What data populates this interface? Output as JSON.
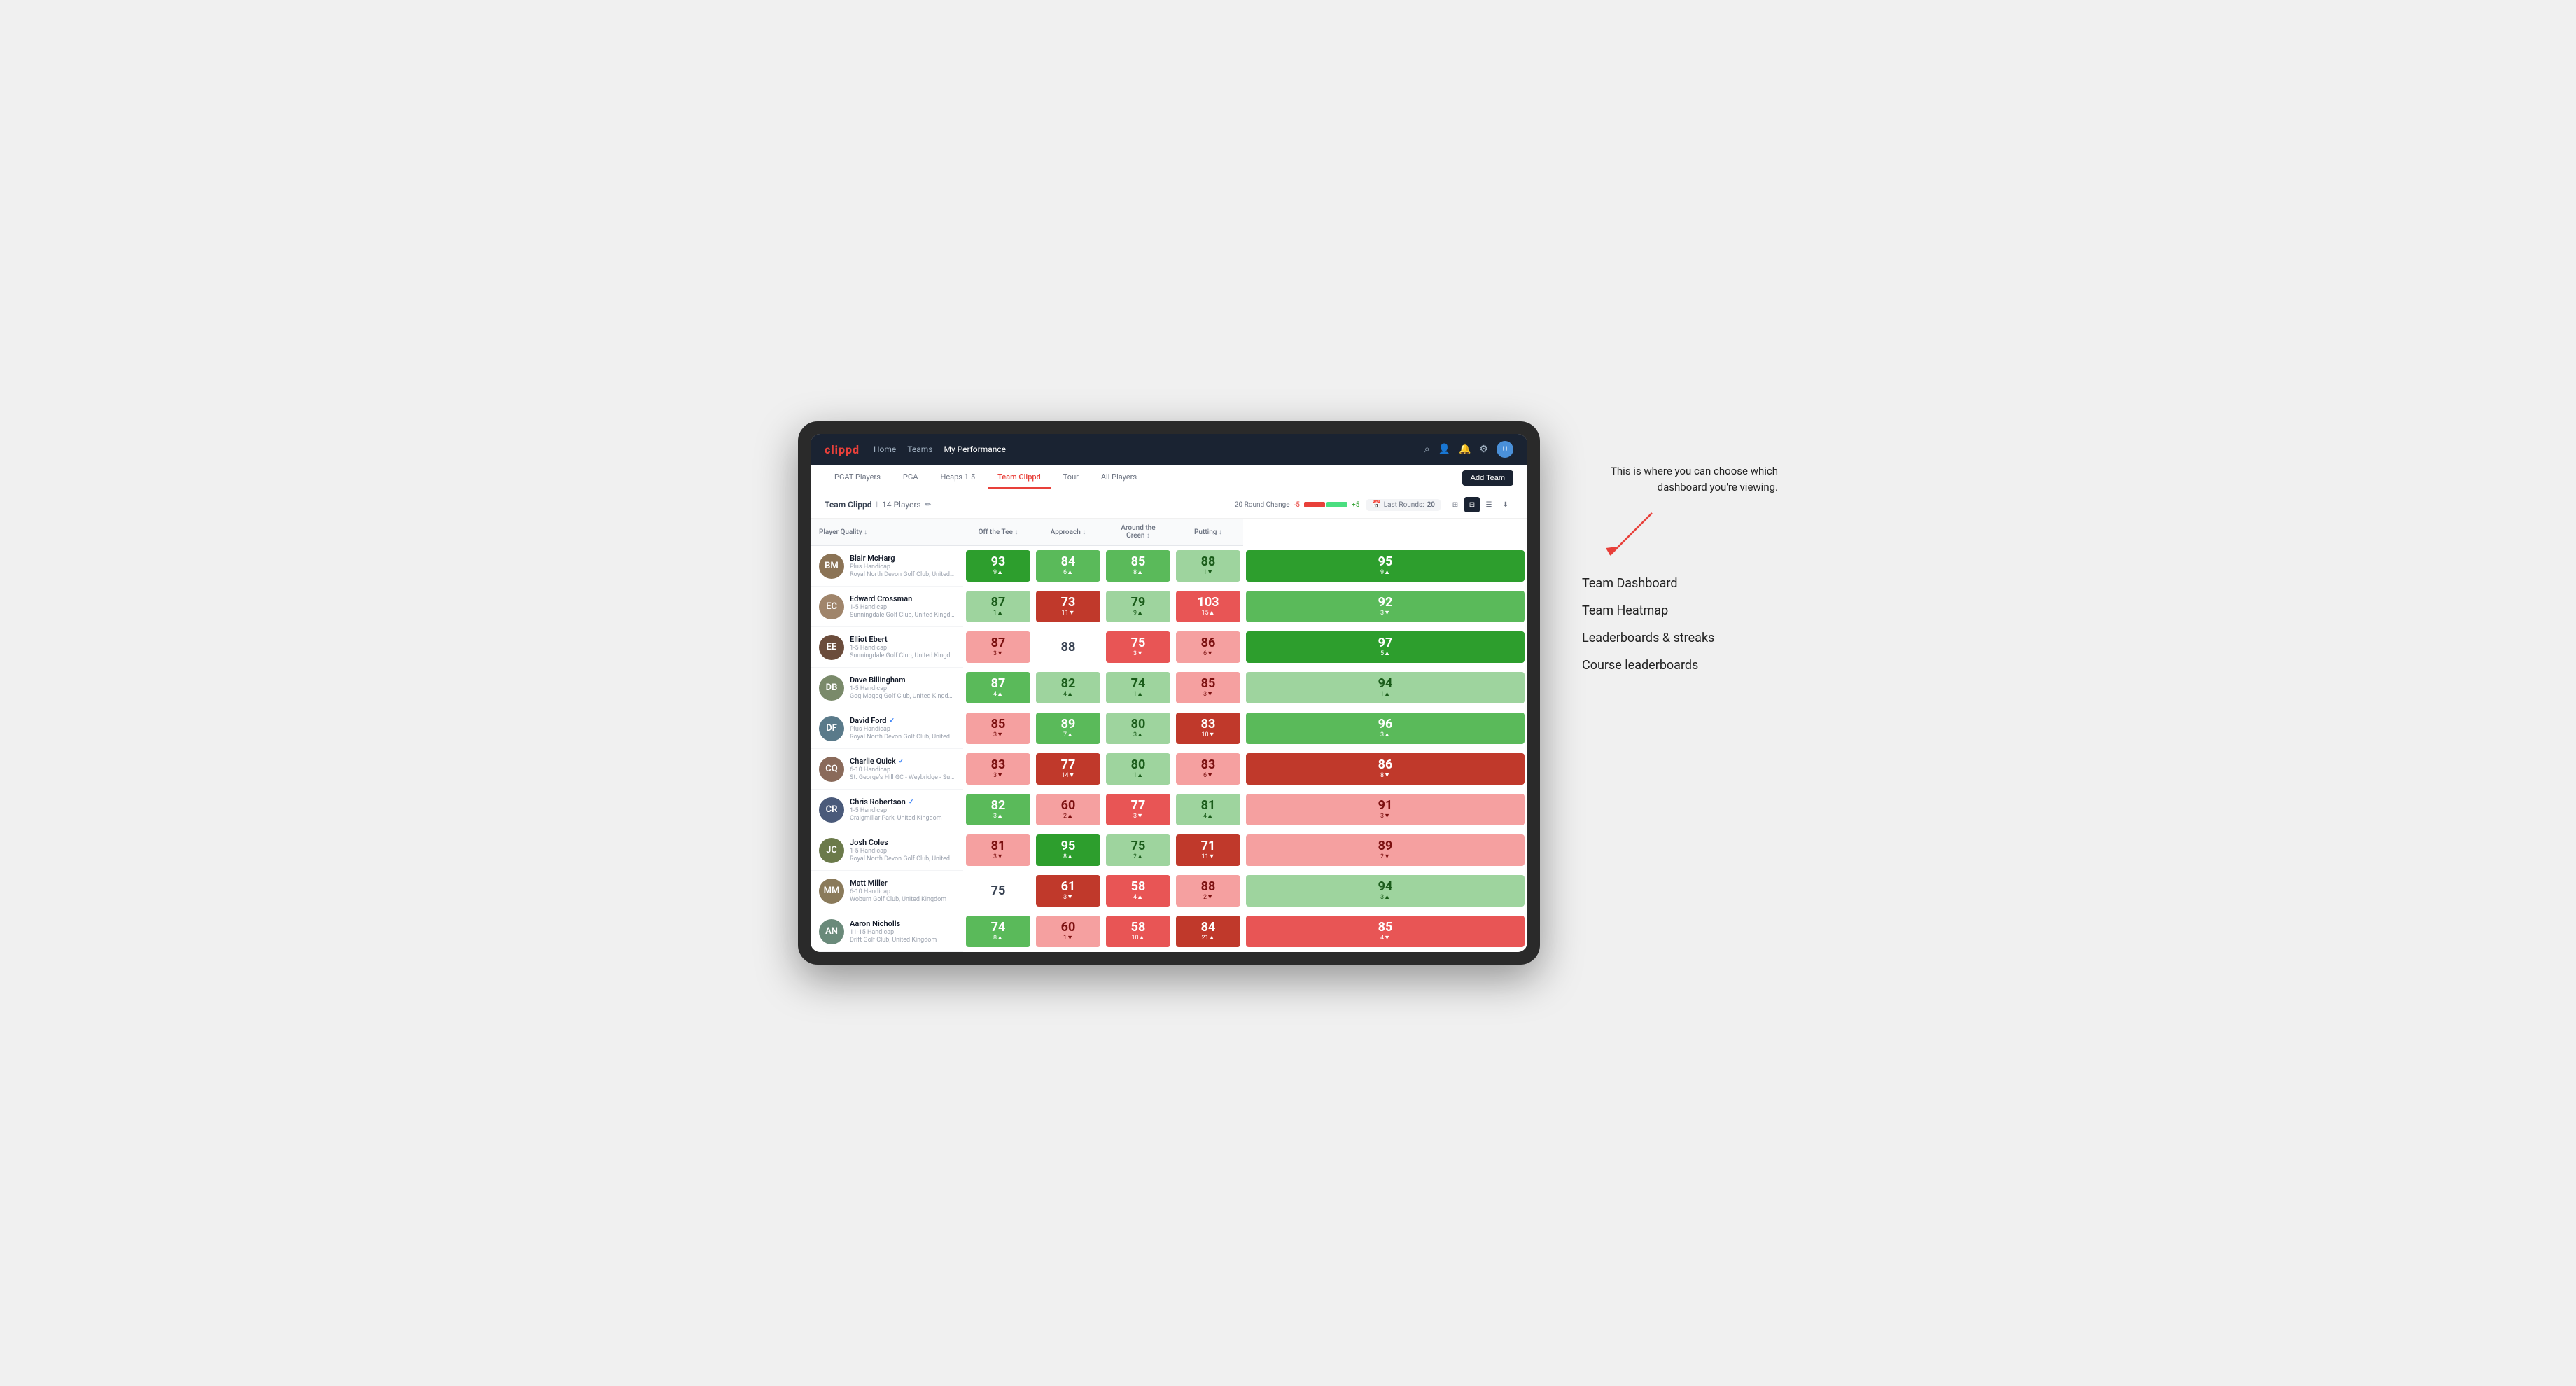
{
  "app": {
    "logo": "clippd",
    "nav": {
      "links": [
        "Home",
        "Teams",
        "My Performance"
      ],
      "active": "My Performance"
    },
    "icons": [
      "search",
      "person",
      "bell",
      "settings",
      "avatar"
    ]
  },
  "subnav": {
    "tabs": [
      "PGAT Players",
      "PGA",
      "Hcaps 1-5",
      "Team Clippd",
      "Tour",
      "All Players"
    ],
    "active": "Team Clippd",
    "add_button": "Add Team"
  },
  "team_header": {
    "title": "Team Clippd",
    "player_count": "14 Players",
    "round_change_label": "20 Round Change",
    "negative": "-5",
    "positive": "+5",
    "last_rounds_label": "Last Rounds:",
    "last_rounds_value": "20"
  },
  "table": {
    "columns": {
      "player": "Player Quality",
      "off_tee": "Off the Tee",
      "approach": "Approach",
      "around_green": "Around the Green",
      "putting": "Putting"
    },
    "rows": [
      {
        "name": "Blair McHarg",
        "handicap": "Plus Handicap",
        "club": "Royal North Devon Golf Club, United Kingdom",
        "avatar_color": "#8b7355",
        "scores": {
          "player_quality": {
            "value": "93",
            "change": "9▲",
            "color": "bg-green-dark"
          },
          "off_tee": {
            "value": "84",
            "change": "6▲",
            "color": "bg-green-mid"
          },
          "approach": {
            "value": "85",
            "change": "8▲",
            "color": "bg-green-mid"
          },
          "around_green": {
            "value": "88",
            "change": "1▼",
            "color": "bg-green-light"
          },
          "putting": {
            "value": "95",
            "change": "9▲",
            "color": "bg-green-dark"
          }
        }
      },
      {
        "name": "Edward Crossman",
        "handicap": "1-5 Handicap",
        "club": "Sunningdale Golf Club, United Kingdom",
        "avatar_color": "#a0856b",
        "scores": {
          "player_quality": {
            "value": "87",
            "change": "1▲",
            "color": "bg-green-light"
          },
          "off_tee": {
            "value": "73",
            "change": "11▼",
            "color": "bg-red-dark"
          },
          "approach": {
            "value": "79",
            "change": "9▲",
            "color": "bg-green-light"
          },
          "around_green": {
            "value": "103",
            "change": "15▲",
            "color": "bg-red-mid"
          },
          "putting": {
            "value": "92",
            "change": "3▼",
            "color": "bg-green-mid"
          }
        }
      },
      {
        "name": "Elliot Ebert",
        "handicap": "1-5 Handicap",
        "club": "Sunningdale Golf Club, United Kingdom",
        "avatar_color": "#6b4c3b",
        "scores": {
          "player_quality": {
            "value": "87",
            "change": "3▼",
            "color": "bg-red-light"
          },
          "off_tee": {
            "value": "88",
            "change": "",
            "color": "bg-white"
          },
          "approach": {
            "value": "75",
            "change": "3▼",
            "color": "bg-red-mid"
          },
          "around_green": {
            "value": "86",
            "change": "6▼",
            "color": "bg-red-light"
          },
          "putting": {
            "value": "97",
            "change": "5▲",
            "color": "bg-green-dark"
          }
        }
      },
      {
        "name": "Dave Billingham",
        "handicap": "1-5 Handicap",
        "club": "Gog Magog Golf Club, United Kingdom",
        "avatar_color": "#7a8a6a",
        "scores": {
          "player_quality": {
            "value": "87",
            "change": "4▲",
            "color": "bg-green-mid"
          },
          "off_tee": {
            "value": "82",
            "change": "4▲",
            "color": "bg-green-light"
          },
          "approach": {
            "value": "74",
            "change": "1▲",
            "color": "bg-green-light"
          },
          "around_green": {
            "value": "85",
            "change": "3▼",
            "color": "bg-red-light"
          },
          "putting": {
            "value": "94",
            "change": "1▲",
            "color": "bg-green-light"
          }
        }
      },
      {
        "name": "David Ford",
        "handicap": "Plus Handicap",
        "club": "Royal North Devon Golf Club, United Kingdom",
        "avatar_color": "#5a7a8a",
        "verified": true,
        "scores": {
          "player_quality": {
            "value": "85",
            "change": "3▼",
            "color": "bg-red-light"
          },
          "off_tee": {
            "value": "89",
            "change": "7▲",
            "color": "bg-green-mid"
          },
          "approach": {
            "value": "80",
            "change": "3▲",
            "color": "bg-green-light"
          },
          "around_green": {
            "value": "83",
            "change": "10▼",
            "color": "bg-red-dark"
          },
          "putting": {
            "value": "96",
            "change": "3▲",
            "color": "bg-green-mid"
          }
        }
      },
      {
        "name": "Charlie Quick",
        "handicap": "6-10 Handicap",
        "club": "St. George's Hill GC - Weybridge - Surrey, Uni...",
        "avatar_color": "#8a6a5a",
        "verified": true,
        "scores": {
          "player_quality": {
            "value": "83",
            "change": "3▼",
            "color": "bg-red-light"
          },
          "off_tee": {
            "value": "77",
            "change": "14▼",
            "color": "bg-red-dark"
          },
          "approach": {
            "value": "80",
            "change": "1▲",
            "color": "bg-green-light"
          },
          "around_green": {
            "value": "83",
            "change": "6▼",
            "color": "bg-red-light"
          },
          "putting": {
            "value": "86",
            "change": "8▼",
            "color": "bg-red-dark"
          }
        }
      },
      {
        "name": "Chris Robertson",
        "handicap": "1-5 Handicap",
        "club": "Craigmillar Park, United Kingdom",
        "avatar_color": "#4a5a7a",
        "verified": true,
        "scores": {
          "player_quality": {
            "value": "82",
            "change": "3▲",
            "color": "bg-green-mid"
          },
          "off_tee": {
            "value": "60",
            "change": "2▲",
            "color": "bg-red-light"
          },
          "approach": {
            "value": "77",
            "change": "3▼",
            "color": "bg-red-mid"
          },
          "around_green": {
            "value": "81",
            "change": "4▲",
            "color": "bg-green-light"
          },
          "putting": {
            "value": "91",
            "change": "3▼",
            "color": "bg-red-light"
          }
        }
      },
      {
        "name": "Josh Coles",
        "handicap": "1-5 Handicap",
        "club": "Royal North Devon Golf Club, United Kingdom",
        "avatar_color": "#6b7a4a",
        "scores": {
          "player_quality": {
            "value": "81",
            "change": "3▼",
            "color": "bg-red-light"
          },
          "off_tee": {
            "value": "95",
            "change": "8▲",
            "color": "bg-green-dark"
          },
          "approach": {
            "value": "75",
            "change": "2▲",
            "color": "bg-green-light"
          },
          "around_green": {
            "value": "71",
            "change": "11▼",
            "color": "bg-red-dark"
          },
          "putting": {
            "value": "89",
            "change": "2▼",
            "color": "bg-red-light"
          }
        }
      },
      {
        "name": "Matt Miller",
        "handicap": "6-10 Handicap",
        "club": "Woburn Golf Club, United Kingdom",
        "avatar_color": "#8a7a5a",
        "scores": {
          "player_quality": {
            "value": "75",
            "change": "",
            "color": "bg-white"
          },
          "off_tee": {
            "value": "61",
            "change": "3▼",
            "color": "bg-red-dark"
          },
          "approach": {
            "value": "58",
            "change": "4▲",
            "color": "bg-red-mid"
          },
          "around_green": {
            "value": "88",
            "change": "2▼",
            "color": "bg-red-light"
          },
          "putting": {
            "value": "94",
            "change": "3▲",
            "color": "bg-green-light"
          }
        }
      },
      {
        "name": "Aaron Nicholls",
        "handicap": "11-15 Handicap",
        "club": "Drift Golf Club, United Kingdom",
        "avatar_color": "#6a8a7a",
        "scores": {
          "player_quality": {
            "value": "74",
            "change": "8▲",
            "color": "bg-green-mid"
          },
          "off_tee": {
            "value": "60",
            "change": "1▼",
            "color": "bg-red-light"
          },
          "approach": {
            "value": "58",
            "change": "10▲",
            "color": "bg-red-mid"
          },
          "around_green": {
            "value": "84",
            "change": "21▲",
            "color": "bg-red-dark"
          },
          "putting": {
            "value": "85",
            "change": "4▼",
            "color": "bg-red-mid"
          }
        }
      }
    ]
  },
  "annotation": {
    "intro_text": "This is where you can choose which dashboard you're viewing.",
    "options": [
      "Team Dashboard",
      "Team Heatmap",
      "Leaderboards & streaks",
      "Course leaderboards"
    ]
  }
}
